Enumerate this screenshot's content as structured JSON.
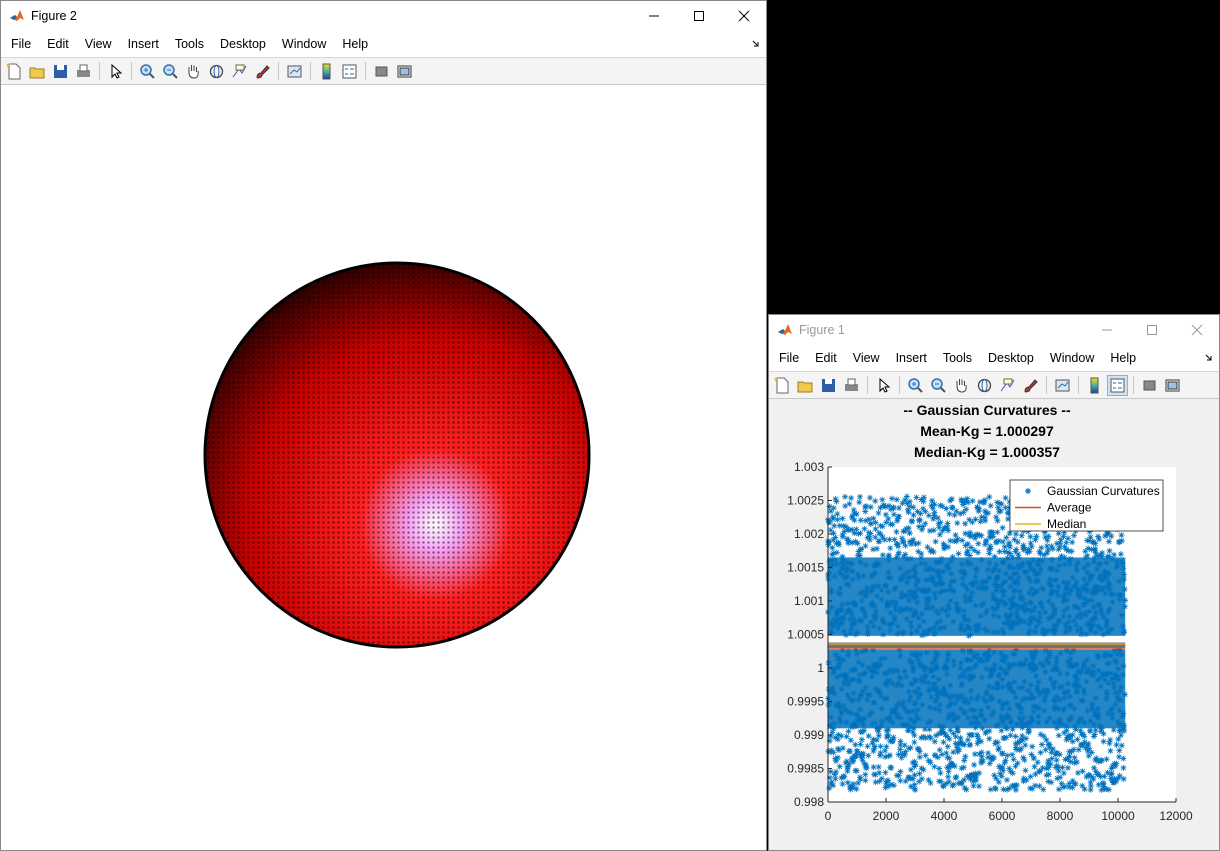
{
  "figure2": {
    "title": "Figure 2",
    "menu": [
      "File",
      "Edit",
      "View",
      "Insert",
      "Tools",
      "Desktop",
      "Window",
      "Help"
    ]
  },
  "figure1": {
    "title": "Figure 1",
    "menu": [
      "File",
      "Edit",
      "View",
      "Insert",
      "Tools",
      "Desktop",
      "Window",
      "Help"
    ]
  },
  "toolbar_icons": [
    "new-file-icon",
    "open-file-icon",
    "save-icon",
    "print-icon",
    "sep",
    "select-arrow-icon",
    "sep",
    "zoom-in-icon",
    "zoom-out-icon",
    "pan-hand-icon",
    "rotate-3d-icon",
    "data-cursor-icon",
    "brush-icon",
    "sep",
    "link-plot-icon",
    "sep",
    "colorbar-icon",
    "legend-icon",
    "sep",
    "hide-plot-tools-icon",
    "show-plot-tools-icon"
  ],
  "chart_data": {
    "type": "scatter",
    "title_lines": [
      "-- Gaussian Curvatures --",
      "Mean-Kg = 1.000297",
      "Median-Kg = 1.000357"
    ],
    "xlim": [
      0,
      12000
    ],
    "ylim": [
      0.998,
      1.003
    ],
    "xticks": [
      "0",
      "2000",
      "4000",
      "6000",
      "8000",
      "10000",
      "12000"
    ],
    "yticks": [
      "0.998",
      "0.9985",
      "0.999",
      "0.9995",
      "1",
      "1.0005",
      "1.001",
      "1.0015",
      "1.002",
      "1.0025",
      "1.003"
    ],
    "point_count_range": [
      0,
      10250
    ],
    "series": [
      {
        "name": "Gaussian Curvatures",
        "marker": "*",
        "color": "#0072BD",
        "y_range": [
          0.99818,
          1.00256
        ]
      },
      {
        "name": "Average",
        "type": "line",
        "color": "#D95319",
        "value": 1.000297
      },
      {
        "name": "Median",
        "type": "line",
        "color": "#EDB120",
        "value": 1.000357
      }
    ],
    "legend_position": "top-right"
  }
}
